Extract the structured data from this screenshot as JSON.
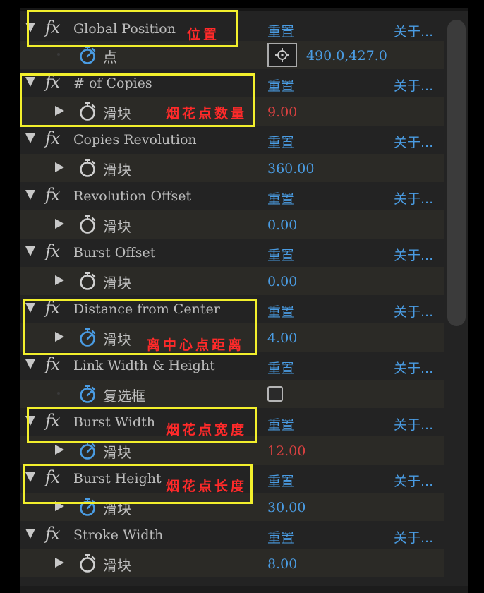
{
  "effects": [
    {
      "name": "Global Position",
      "reset_label": "重置",
      "about_label": "关于...",
      "sub": {
        "type": "point",
        "label": "点",
        "value": "490.0,427.0",
        "value_color": "blue"
      }
    },
    {
      "name": "# of Copies",
      "reset_label": "重置",
      "about_label": "关于...",
      "sub": {
        "type": "slider",
        "label": "滑块",
        "value": "9.00",
        "value_color": "red"
      }
    },
    {
      "name": "Copies Revolution",
      "reset_label": "重置",
      "about_label": "关于...",
      "sub": {
        "type": "slider",
        "label": "滑块",
        "value": "360.00",
        "value_color": "blue"
      }
    },
    {
      "name": "Revolution Offset",
      "reset_label": "重置",
      "about_label": "关于...",
      "sub": {
        "type": "slider",
        "label": "滑块",
        "value": "0.00",
        "value_color": "blue"
      }
    },
    {
      "name": "Burst Offset",
      "reset_label": "重置",
      "about_label": "关于...",
      "sub": {
        "type": "slider",
        "label": "滑块",
        "value": "0.00",
        "value_color": "blue"
      }
    },
    {
      "name": "Distance from Center",
      "reset_label": "重置",
      "about_label": "关于...",
      "sub": {
        "type": "slider",
        "label": "滑块",
        "value": "4.00",
        "value_color": "blue"
      }
    },
    {
      "name": "Link Width & Height",
      "reset_label": "重置",
      "about_label": "关于...",
      "sub": {
        "type": "checkbox",
        "label": "复选框",
        "value": "",
        "checked": false
      }
    },
    {
      "name": "Burst Width",
      "reset_label": "重置",
      "about_label": "关于...",
      "sub": {
        "type": "slider",
        "label": "滑块",
        "value": "12.00",
        "value_color": "red"
      }
    },
    {
      "name": "Burst Height",
      "reset_label": "重置",
      "about_label": "关于...",
      "sub": {
        "type": "slider",
        "label": "滑块",
        "value": "30.00",
        "value_color": "blue"
      }
    },
    {
      "name": "Stroke Width",
      "reset_label": "重置",
      "about_label": "关于...",
      "sub": {
        "type": "slider",
        "label": "滑块",
        "value": "8.00",
        "value_color": "blue"
      }
    }
  ],
  "annotations": [
    {
      "text": "位置"
    },
    {
      "text": "烟花点数量"
    },
    {
      "text": "离中心点距离"
    },
    {
      "text": "烟花点宽度"
    },
    {
      "text": "烟花点长度"
    }
  ],
  "colors": {
    "panel_bg": "#232323",
    "subrow_bg": "#2b2a26",
    "link_blue": "#4a9ce3",
    "value_red": "#d94040",
    "annotation_box": "#f2ef2c",
    "annotation_text": "#ff2a2a"
  },
  "icons": {
    "expand": "triangle-down-icon",
    "collapse": "triangle-right-icon",
    "fx": "fx-icon",
    "stopwatch": "stopwatch-icon",
    "target": "crosshair-icon"
  }
}
